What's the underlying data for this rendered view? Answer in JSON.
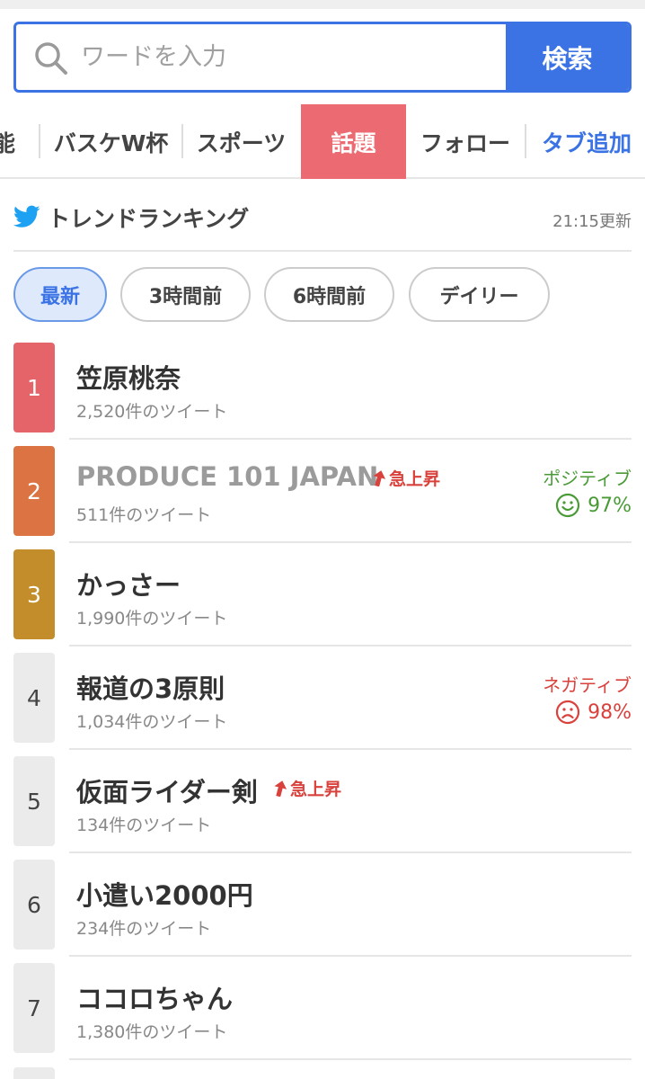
{
  "search": {
    "placeholder": "ワードを入力",
    "button_label": "検索"
  },
  "tabs": [
    {
      "label": "能",
      "active": false
    },
    {
      "label": "バスケW杯",
      "active": false
    },
    {
      "label": "スポーツ",
      "active": false
    },
    {
      "label": "話題",
      "active": true
    },
    {
      "label": "フォロー",
      "active": false
    },
    {
      "label": "タブ追加",
      "active": false
    }
  ],
  "section": {
    "icon": "twitter-bird-icon",
    "title": "トレンドランキング",
    "updated": "21:15更新"
  },
  "filters": [
    {
      "label": "最新",
      "active": true
    },
    {
      "label": "3時間前",
      "active": false
    },
    {
      "label": "6時間前",
      "active": false
    },
    {
      "label": "デイリー",
      "active": false
    }
  ],
  "surge_label": "急上昇",
  "rankings": [
    {
      "rank": "1",
      "title": "笠原桃奈",
      "count": "2,520件のツイート"
    },
    {
      "rank": "2",
      "title": "PRODUCE 101 JAPAN",
      "count": "511件のツイート",
      "surge": true,
      "sentiment": {
        "label": "ポジティブ",
        "value": "97%",
        "type": "positive"
      }
    },
    {
      "rank": "3",
      "title": "かっさー",
      "count": "1,990件のツイート"
    },
    {
      "rank": "4",
      "title": "報道の3原則",
      "count": "1,034件のツイート",
      "sentiment": {
        "label": "ネガティブ",
        "value": "98%",
        "type": "negative"
      }
    },
    {
      "rank": "5",
      "title": "仮面ライダー剣",
      "count": "134件のツイート",
      "surge": true
    },
    {
      "rank": "6",
      "title": "小遣い2000円",
      "count": "234件のツイート"
    },
    {
      "rank": "7",
      "title": "ココロちゃん",
      "count": "1,380件のツイート"
    }
  ],
  "colors": {
    "accent": "#3b73e5",
    "active_tab": "#ec6b73",
    "rank1": "#e4646a",
    "rank2": "#db7442",
    "rank3": "#c48d2c",
    "positive": "#4a9b37",
    "negative": "#d9423c"
  }
}
